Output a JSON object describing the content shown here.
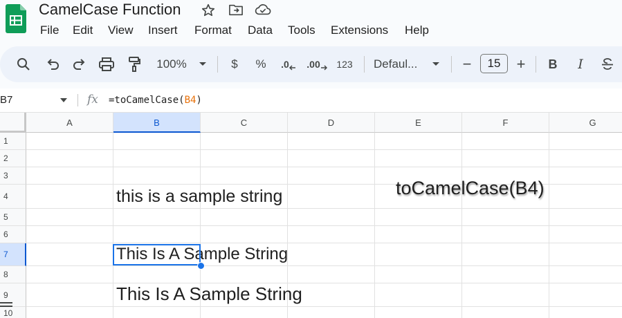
{
  "app": {
    "doc_title": "CamelCase Function",
    "colors": {
      "logo_green": "#0f9d58",
      "selection_blue": "#1a73e8",
      "formula_ref_orange": "#e8710a"
    }
  },
  "menu": [
    "File",
    "Edit",
    "View",
    "Insert",
    "Format",
    "Data",
    "Tools",
    "Extensions",
    "Help"
  ],
  "toolbar": {
    "zoom": "100%",
    "currency": "$",
    "percent": "%",
    "decrease_decimals": ".0",
    "increase_decimals": ".00",
    "number_format": "123",
    "font": "Defaul...",
    "font_size": "15",
    "minus": "−",
    "plus": "+",
    "bold": "B",
    "italic": "I"
  },
  "formula_bar": {
    "name_box": "B7",
    "fx": "fx",
    "formula_prefix": "=toCamelCase(",
    "formula_ref": "B4",
    "formula_suffix": ")"
  },
  "grid": {
    "columns": [
      "A",
      "B",
      "C",
      "D",
      "E",
      "F",
      "G"
    ],
    "rows": [
      "1",
      "2",
      "3",
      "4",
      "5",
      "6",
      "7",
      "8",
      "9",
      "10"
    ],
    "cells": {
      "B4": "this is a sample string",
      "B7": "This Is A Sample String",
      "B9": "This Is A Sample String",
      "E4": "toCamelCase(B4)"
    },
    "selected_cell": "B7"
  }
}
